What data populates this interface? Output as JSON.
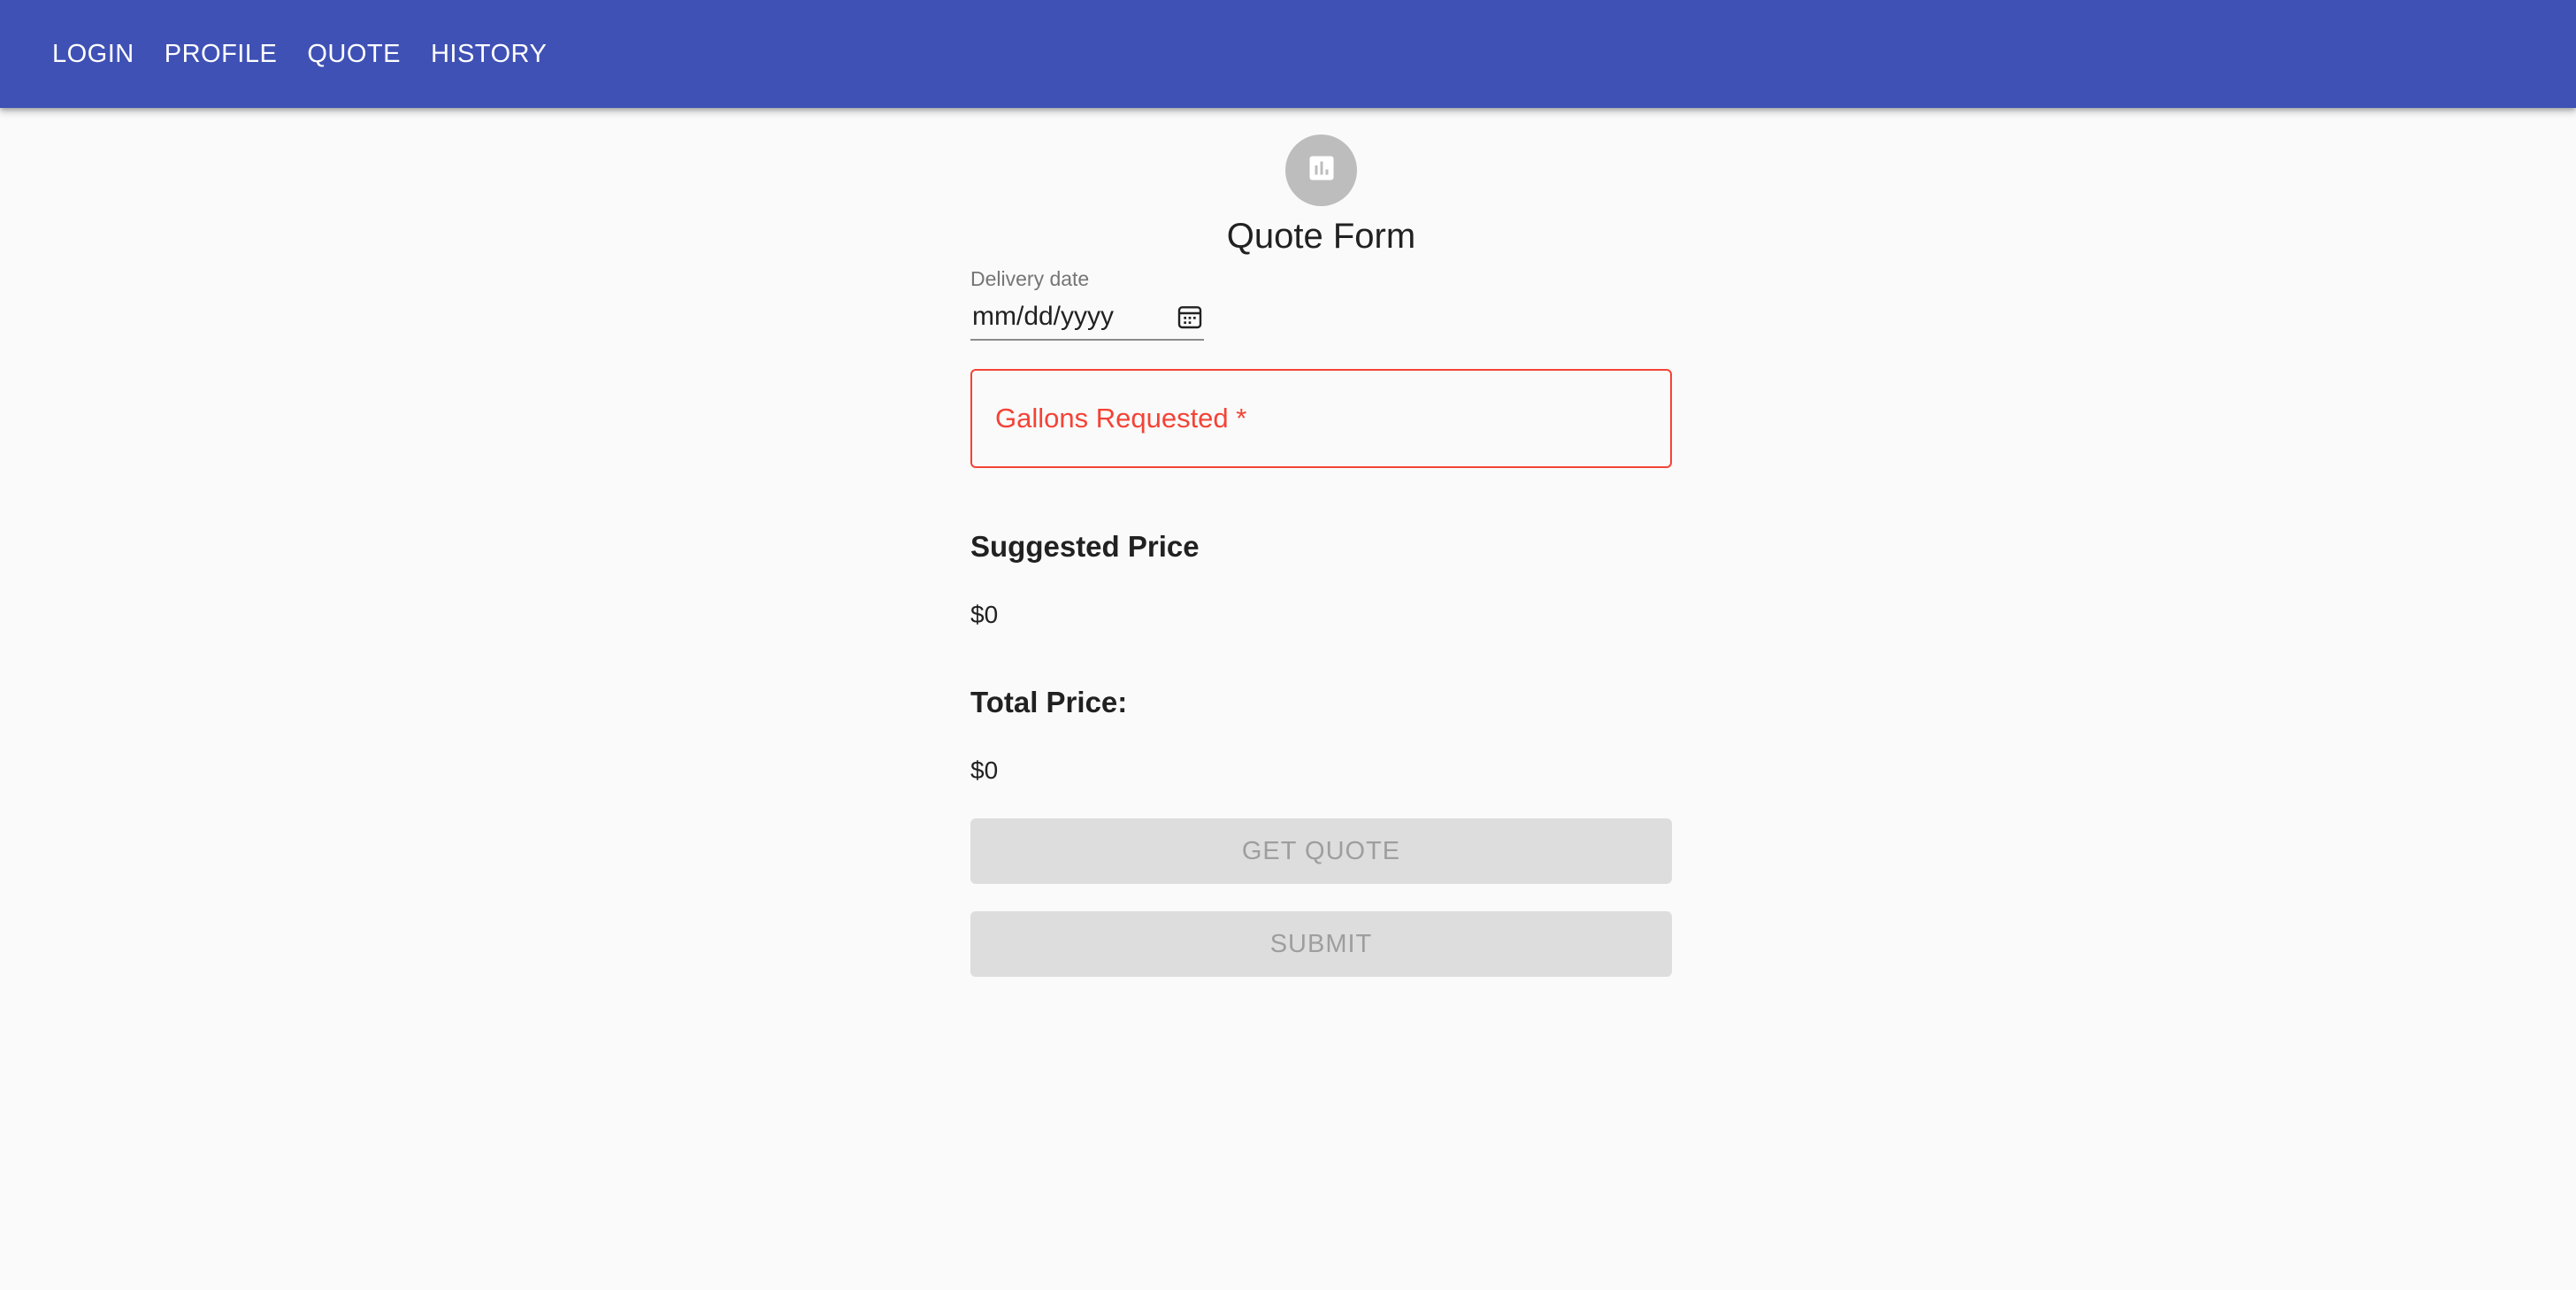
{
  "nav": {
    "items": [
      {
        "label": "LOGIN"
      },
      {
        "label": "PROFILE"
      },
      {
        "label": "QUOTE"
      },
      {
        "label": "HISTORY"
      }
    ],
    "background": "#3f51b5"
  },
  "form": {
    "icon": "bar-chart-icon",
    "title": "Quote Form",
    "delivery_date": {
      "label": "Delivery date",
      "placeholder": "mm/dd/yyyy",
      "icon": "calendar-icon"
    },
    "gallons": {
      "label": "Gallons Requested *",
      "error_color": "#f44336"
    },
    "suggested_price": {
      "heading": "Suggested Price",
      "value": "$0"
    },
    "total_price": {
      "heading": "Total Price:",
      "value": "$0"
    },
    "buttons": {
      "get_quote": "GET QUOTE",
      "submit": "SUBMIT"
    }
  }
}
